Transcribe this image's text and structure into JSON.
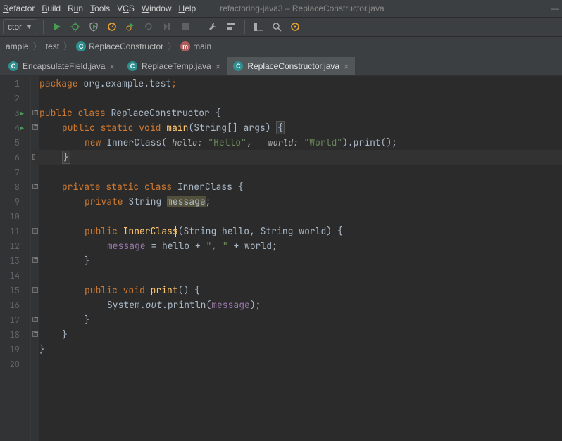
{
  "menu": {
    "items": [
      "Refactor",
      "Build",
      "Run",
      "Tools",
      "VCS",
      "Window",
      "Help"
    ],
    "windowTitle": "refactoring-java3 – ReplaceConstructor.java"
  },
  "toolbar": {
    "runConfig": "ctor"
  },
  "breadcrumbs": {
    "items": [
      "ample",
      "test",
      "ReplaceConstructor",
      "main"
    ]
  },
  "tabs": [
    {
      "label": "EncapsulateField.java",
      "active": false
    },
    {
      "label": "ReplaceTemp.java",
      "active": false
    },
    {
      "label": "ReplaceConstructor.java",
      "active": true
    }
  ],
  "code": {
    "packageLine": {
      "kw": "package",
      "pkg": "org.example.test",
      "semi": ";"
    },
    "line3": {
      "pub": "public",
      "cls": "class",
      "name": "ReplaceConstructor",
      "brace": "{"
    },
    "line4": {
      "pub": "public",
      "stat": "static",
      "void": "void",
      "main": "main",
      "sig1": "(String[] ",
      "args": "args",
      "sig2": ") ",
      "brace": "{"
    },
    "line5": {
      "new": "new",
      "ctor": "InnerClass",
      "lp": "( ",
      "p1": "hello:",
      "sp1": " ",
      "s1": "\"Hello\"",
      "comma": ",   ",
      "p2": "world:",
      "sp2": " ",
      "s2": "\"World\"",
      "tail": ").print();"
    },
    "line6": {
      "brace": "}"
    },
    "line8": {
      "priv": "private",
      "stat": "static",
      "cls": "class",
      "name": "InnerClass",
      "brace": " {"
    },
    "line9": {
      "priv": "private",
      "type": "String",
      "field": "message",
      "semi": ";"
    },
    "line11": {
      "pub": "public",
      "name": "InnerClass",
      "sig": "(String ",
      "a1": "hello",
      "c1": ", ",
      "t2": "String ",
      "a2": "world",
      "sig2": ") {"
    },
    "line12": {
      "field": "message",
      "eq": " = ",
      "a1": "hello",
      "plus": " + ",
      "s": "\", \"",
      "plus2": " + ",
      "a2": "world",
      "semi": ";"
    },
    "line13": {
      "brace": "}"
    },
    "line15": {
      "pub": "public",
      "void": "void",
      "name": "print",
      "sig": "() {"
    },
    "line16": {
      "sys": "System.",
      "out": "out",
      "dot": ".println(",
      "field": "message",
      "tail": ");"
    },
    "line17": {
      "brace": "}"
    },
    "line18": {
      "brace": "}"
    },
    "line19": {
      "brace": "}"
    }
  }
}
